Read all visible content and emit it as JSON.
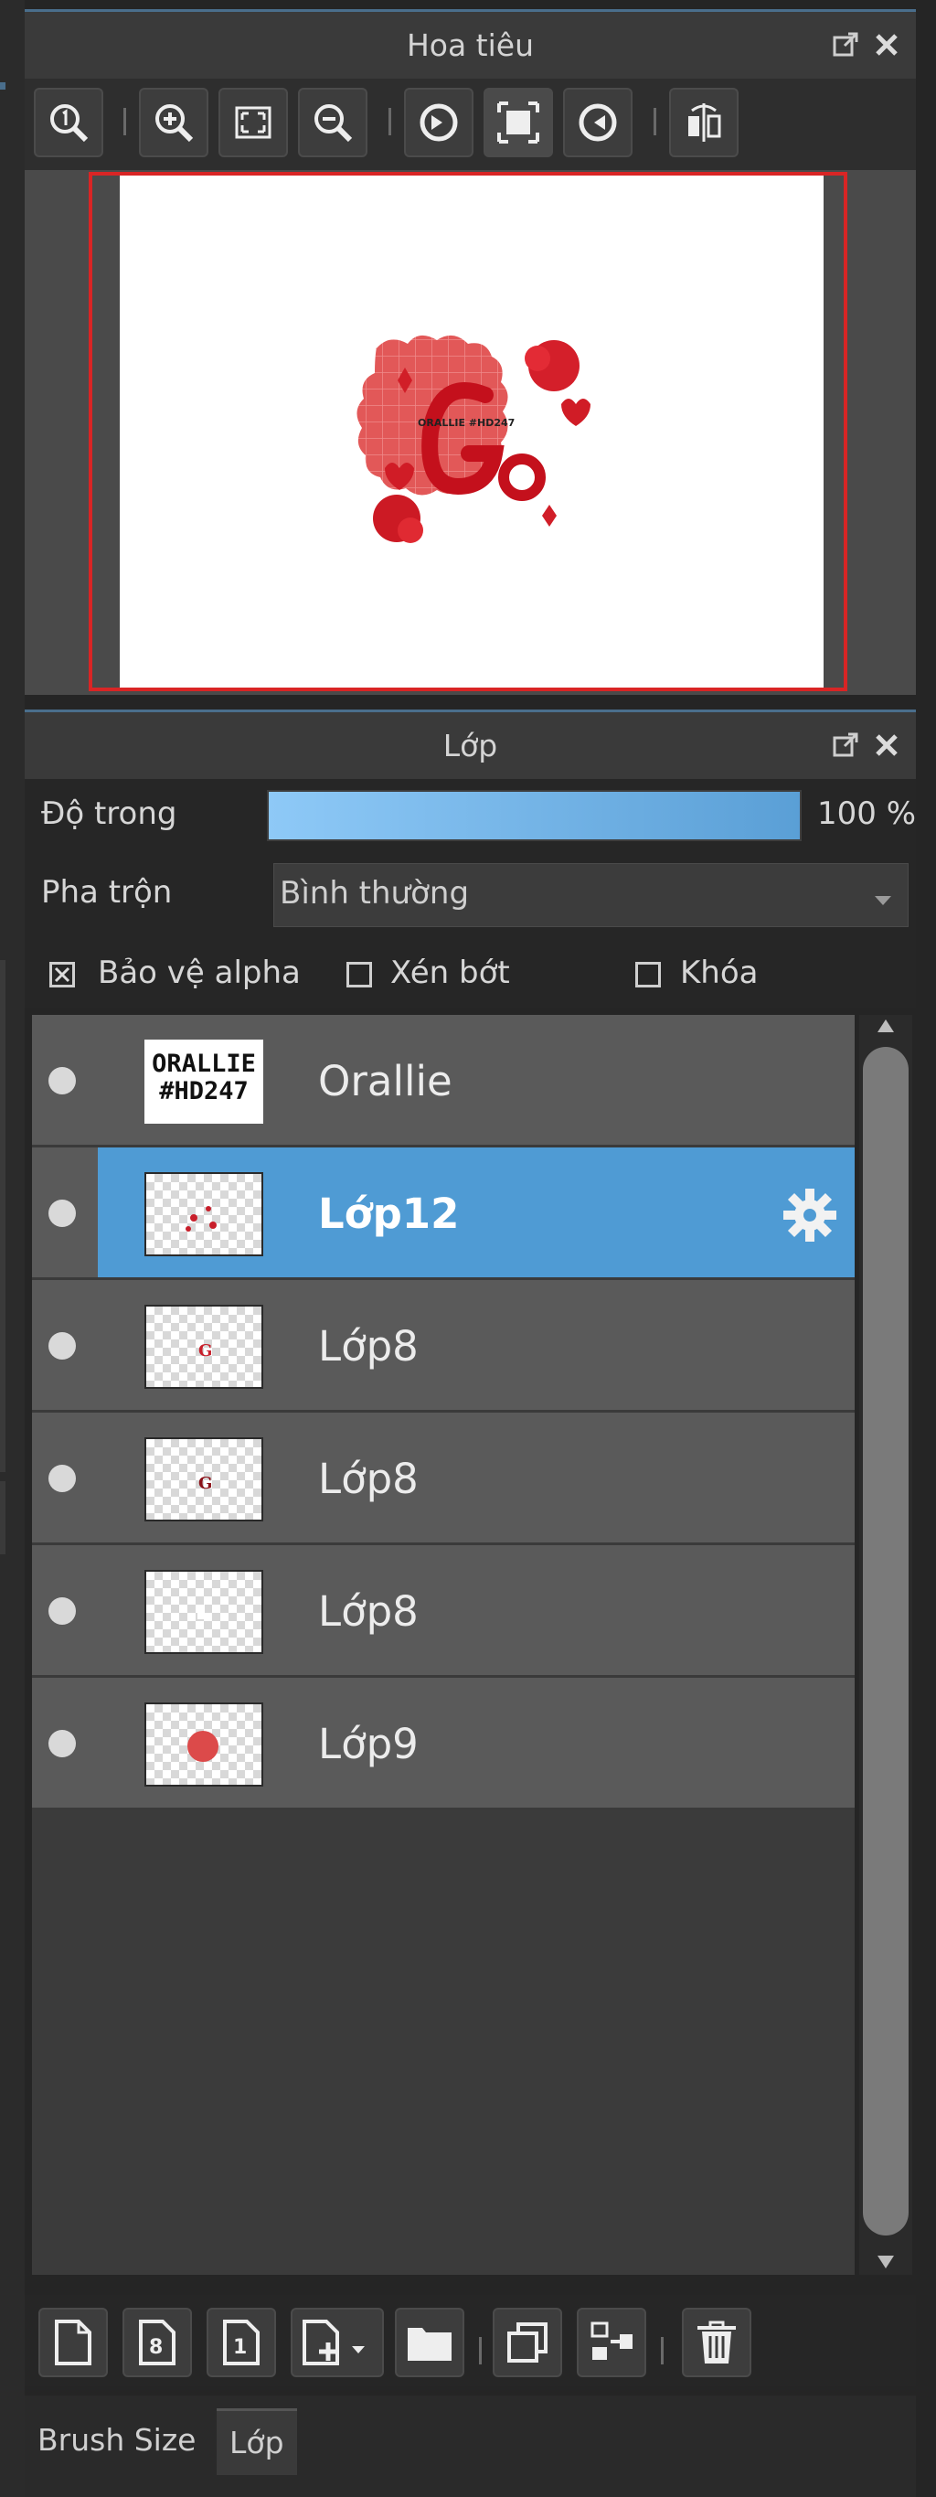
{
  "navigator": {
    "title": "Hoa tiêu",
    "toolbar_icons": [
      "zoom-actual-icon",
      "zoom-in-icon",
      "fit-screen-icon",
      "zoom-out-icon",
      "rotate-left-icon",
      "fit-canvas-icon",
      "rotate-right-icon",
      "flip-horizontal-icon"
    ],
    "preview_text": "ORALLIE #HD247"
  },
  "layers_panel": {
    "title": "Lớp",
    "opacity_label": "Độ trong",
    "opacity_value": "100 %",
    "opacity_fraction": 1.0,
    "blend_label": "Pha trộn",
    "blend_value": "Bình thường",
    "checkbox_protect_alpha": "Bảo vệ alpha",
    "checkbox_clipping": "Xén bớt",
    "checkbox_lock": "Khóa",
    "protect_alpha_checked": true,
    "clipping_checked": false,
    "lock_checked": false,
    "layers": [
      {
        "name": "Orallie",
        "thumb_text": "ORALLIE #HD247",
        "selected": false
      },
      {
        "name": "Lớp12",
        "selected": true
      },
      {
        "name": "Lớp8",
        "selected": false
      },
      {
        "name": "Lớp8",
        "selected": false
      },
      {
        "name": "Lớp8",
        "selected": false
      },
      {
        "name": "Lớp9",
        "selected": false
      }
    ]
  },
  "bottom_toolbar_icons": [
    "new-layer-icon",
    "new-8bit-layer-icon",
    "new-1bit-layer-icon",
    "add-layer-menu-icon",
    "new-folder-icon",
    "duplicate-layer-icon",
    "merge-down-icon",
    "delete-layer-icon"
  ],
  "bottom_tabs": {
    "tab1": "Brush Size",
    "tab2": "Lớp"
  },
  "colors": {
    "accent_blue": "#4f9bd4",
    "frame_red": "#d92525",
    "art_red": "#e03a3a"
  }
}
